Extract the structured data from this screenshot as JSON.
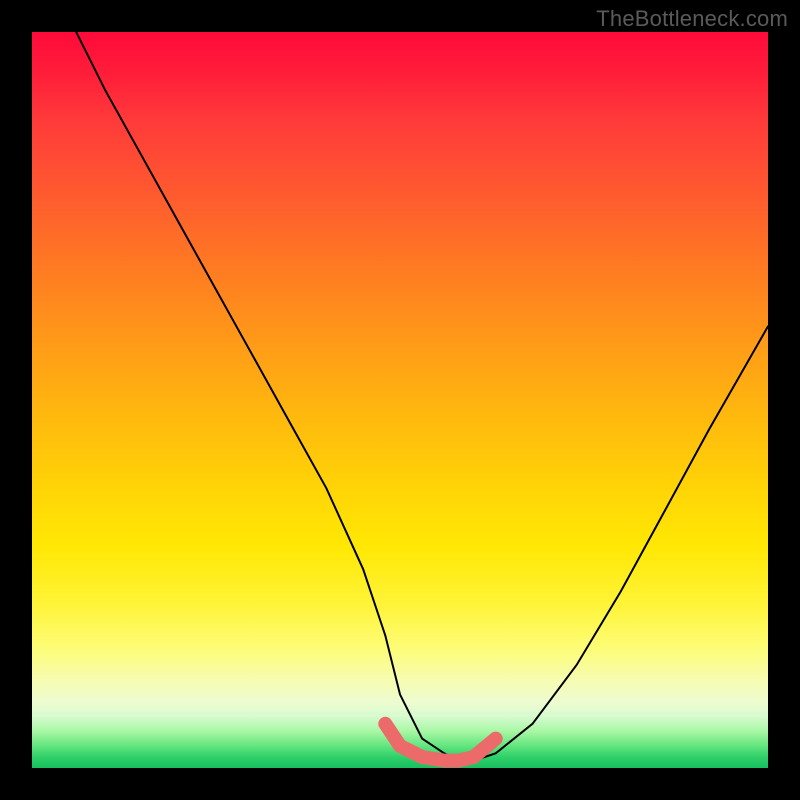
{
  "watermark": "TheBottleneck.com",
  "colors": {
    "frame": "#000000",
    "curve": "#000000",
    "bottom_marker": "#ec6a6a"
  },
  "chart_data": {
    "type": "line",
    "title": "",
    "xlabel": "",
    "ylabel": "",
    "xlim": [
      0,
      100
    ],
    "ylim": [
      0,
      100
    ],
    "grid": false,
    "legend": false,
    "note": "No axes or tick labels are rendered. Values are read off as percentages of the plot area (x left→right, y bottom→top).",
    "series": [
      {
        "name": "curve",
        "x": [
          6,
          10,
          15,
          20,
          25,
          30,
          35,
          40,
          45,
          48,
          50,
          53,
          56,
          58,
          60,
          63,
          68,
          74,
          80,
          86,
          92,
          100
        ],
        "y": [
          100,
          92,
          83,
          74,
          65,
          56,
          47,
          38,
          27,
          18,
          10,
          4,
          2,
          1,
          1,
          2,
          6,
          14,
          24,
          35,
          46,
          60
        ]
      }
    ],
    "bottom_marker": {
      "name": "optimal-range",
      "x": [
        48,
        50,
        53,
        56,
        58,
        60,
        63
      ],
      "y": [
        6,
        3,
        1.5,
        1,
        1,
        1.5,
        4
      ]
    },
    "gradient_stops_top_to_bottom": [
      {
        "pos": 0.0,
        "color": "#ff0a3a"
      },
      {
        "pos": 0.32,
        "color": "#ff7a22"
      },
      {
        "pos": 0.62,
        "color": "#ffd406"
      },
      {
        "pos": 0.84,
        "color": "#fdfd7a"
      },
      {
        "pos": 0.95,
        "color": "#a8f7a4"
      },
      {
        "pos": 1.0,
        "color": "#17c05f"
      }
    ]
  }
}
